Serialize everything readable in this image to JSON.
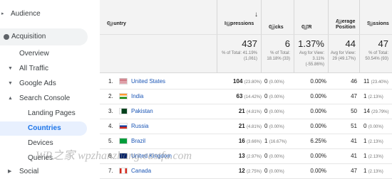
{
  "sidebar": {
    "audience": "Audience",
    "acquisition": "Acquisition",
    "overview": "Overview",
    "all_traffic": "All Traffic",
    "google_ads": "Google Ads",
    "search_console": "Search Console",
    "landing_pages": "Landing Pages",
    "countries": "Countries",
    "devices": "Devices",
    "queries": "Queries",
    "social": "Social"
  },
  "table": {
    "headers": {
      "country": "Country",
      "impressions": "Impressions",
      "clicks": "Clicks",
      "ctr": "CTR",
      "avg_pos": "Average Position",
      "sessions": "Sessions"
    },
    "summary": {
      "impressions": {
        "value": "437",
        "sub": "% of Total: 41.19% (1,061)"
      },
      "clicks": {
        "value": "6",
        "sub": "% of Total: 18.18% (33)"
      },
      "ctr": {
        "value": "1.37%",
        "sub": "Avg for View: 3.11% (-55.86%)"
      },
      "avg_pos": {
        "value": "44",
        "sub": "Avg for View: 29 (49.17%)"
      },
      "sessions": {
        "value": "47",
        "sub": "% of Total: 50.54% (93)"
      }
    },
    "rows": [
      {
        "rank": "1.",
        "country": "United States",
        "imp": "104",
        "imp_pct": "(23.80%)",
        "clk": "0",
        "clk_pct": "(0.00%)",
        "ctr": "0.00%",
        "pos": "46",
        "ses": "11",
        "ses_pct": "(23.40%)",
        "flag": "us"
      },
      {
        "rank": "2.",
        "country": "India",
        "imp": "63",
        "imp_pct": "(14.42%)",
        "clk": "0",
        "clk_pct": "(0.00%)",
        "ctr": "0.00%",
        "pos": "47",
        "ses": "1",
        "ses_pct": "(2.13%)",
        "flag": "in"
      },
      {
        "rank": "3.",
        "country": "Pakistan",
        "imp": "21",
        "imp_pct": "(4.81%)",
        "clk": "0",
        "clk_pct": "(0.00%)",
        "ctr": "0.00%",
        "pos": "50",
        "ses": "14",
        "ses_pct": "(29.79%)",
        "flag": "pk"
      },
      {
        "rank": "4.",
        "country": "Russia",
        "imp": "21",
        "imp_pct": "(4.81%)",
        "clk": "0",
        "clk_pct": "(0.00%)",
        "ctr": "0.00%",
        "pos": "51",
        "ses": "0",
        "ses_pct": "(0.00%)",
        "flag": "ru"
      },
      {
        "rank": "5.",
        "country": "Brazil",
        "imp": "16",
        "imp_pct": "(3.66%)",
        "clk": "1",
        "clk_pct": "(16.67%)",
        "ctr": "6.25%",
        "pos": "41",
        "ses": "1",
        "ses_pct": "(2.13%)",
        "flag": "br"
      },
      {
        "rank": "6.",
        "country": "United Kingdom",
        "imp": "13",
        "imp_pct": "(2.97%)",
        "clk": "0",
        "clk_pct": "(0.00%)",
        "ctr": "0.00%",
        "pos": "41",
        "ses": "1",
        "ses_pct": "(2.13%)",
        "flag": "uk"
      },
      {
        "rank": "7.",
        "country": "Canada",
        "imp": "12",
        "imp_pct": "(2.75%)",
        "clk": "0",
        "clk_pct": "(0.00%)",
        "ctr": "0.00%",
        "pos": "47",
        "ses": "1",
        "ses_pct": "(2.13%)",
        "flag": "ca"
      }
    ]
  },
  "watermark": "WP之家 wpzhanzhang.eastfu.com",
  "colors": {
    "link": "#1a55b5",
    "selected_bg": "#e8f0fe",
    "accent": "#1a73e8"
  }
}
